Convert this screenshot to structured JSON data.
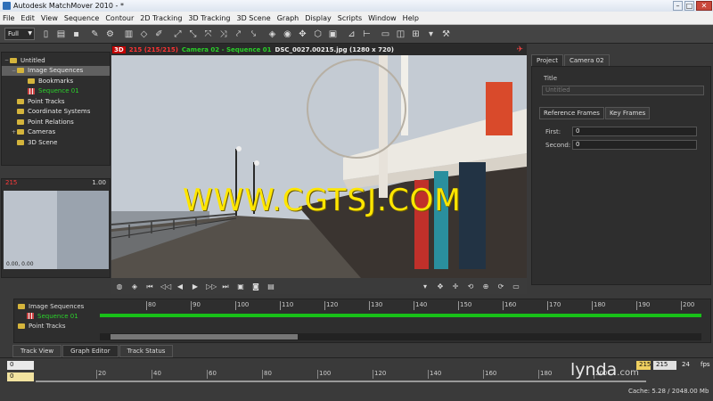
{
  "window": {
    "title": "Autodesk MatchMover 2010 - *"
  },
  "menu": [
    "File",
    "Edit",
    "View",
    "Sequence",
    "Contour",
    "2D Tracking",
    "3D Tracking",
    "3D Scene",
    "Graph",
    "Display",
    "Scripts",
    "Window",
    "Help"
  ],
  "toolbar": {
    "mode_select": "Full"
  },
  "tree": {
    "items": [
      {
        "label": "Untitled",
        "depth": 0
      },
      {
        "label": "Image Sequences",
        "depth": 1,
        "selected": true
      },
      {
        "label": "Bookmarks",
        "depth": 2
      },
      {
        "label": "Sequence 01",
        "depth": 2,
        "active": true
      },
      {
        "label": "Point Tracks",
        "depth": 1
      },
      {
        "label": "Coordinate Systems",
        "depth": 1
      },
      {
        "label": "Point Relations",
        "depth": 1
      },
      {
        "label": "Cameras",
        "depth": 1
      },
      {
        "label": "3D Scene",
        "depth": 1
      }
    ]
  },
  "mini_view": {
    "frame": "215",
    "zoom": "1.00",
    "coords": "0.00, 0.00"
  },
  "viewport": {
    "badge": "3D",
    "frame_info": "215 (215/215)",
    "camera": "Camera 02 - Sequence 01",
    "image": "DSC_0027.00215.jpg (1280 x 720)",
    "watermark": "WWW.CGTSJ.COM"
  },
  "right_panel": {
    "tabs": [
      "Project",
      "Camera 02"
    ],
    "title_label": "Title",
    "title_value": "Untitled",
    "sub_tabs": [
      "Reference Frames",
      "Key Frames"
    ],
    "first_label": "First:",
    "first_value": "0",
    "second_label": "Second:",
    "second_value": "0"
  },
  "timeline": {
    "tree": [
      "Image Sequences",
      "Sequence 01",
      "Point Tracks"
    ],
    "ticks": [
      "80",
      "90",
      "100",
      "110",
      "120",
      "130",
      "140",
      "150",
      "160",
      "170",
      "180",
      "190",
      "200"
    ]
  },
  "bottom_tabs": [
    "Track View",
    "Graph Editor",
    "Track Status"
  ],
  "range": {
    "start_a": "0",
    "start_b": "0",
    "ticks": [
      "20",
      "40",
      "60",
      "80",
      "100",
      "120",
      "140",
      "160",
      "180",
      "200"
    ],
    "end_frame": "215",
    "current": "215",
    "fps_value": "24",
    "fps_label": "fps",
    "cache": "Cache: 5.28 / 2048.00 Mb"
  },
  "brand": {
    "name": "lynda",
    "suffix": ".com"
  }
}
